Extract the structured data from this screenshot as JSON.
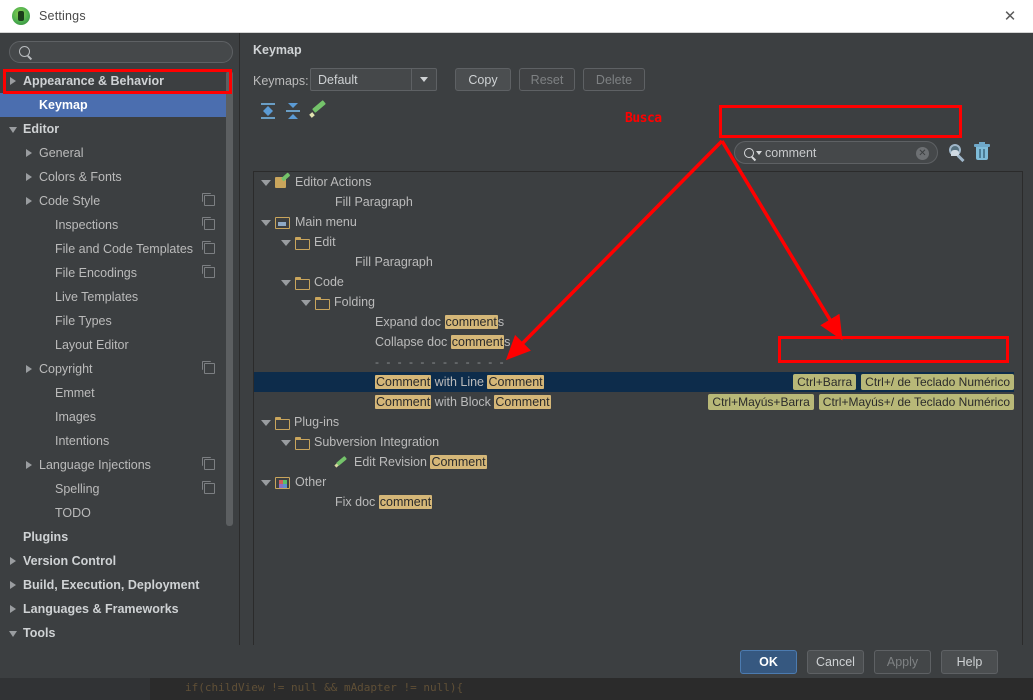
{
  "window": {
    "title": "Settings",
    "icon": "android-studio-icon",
    "close_label": "✕"
  },
  "sidebar": {
    "search_placeholder": "",
    "search_value": "",
    "search_icon": "search-icon",
    "items": [
      {
        "label": "Appearance & Behavior",
        "indent": 0,
        "twisty": "right",
        "bold": true,
        "badge": false,
        "selected": false
      },
      {
        "label": "Keymap",
        "indent": 1,
        "twisty": "none",
        "bold": true,
        "badge": false,
        "selected": true
      },
      {
        "label": "Editor",
        "indent": 0,
        "twisty": "down",
        "bold": true,
        "badge": false,
        "selected": false
      },
      {
        "label": "General",
        "indent": 1,
        "twisty": "right",
        "bold": false,
        "badge": false,
        "selected": false
      },
      {
        "label": "Colors & Fonts",
        "indent": 1,
        "twisty": "right",
        "bold": false,
        "badge": false,
        "selected": false
      },
      {
        "label": "Code Style",
        "indent": 1,
        "twisty": "right",
        "bold": false,
        "badge": true,
        "selected": false
      },
      {
        "label": "Inspections",
        "indent": 2,
        "twisty": "none",
        "bold": false,
        "badge": true,
        "selected": false
      },
      {
        "label": "File and Code Templates",
        "indent": 2,
        "twisty": "none",
        "bold": false,
        "badge": true,
        "selected": false
      },
      {
        "label": "File Encodings",
        "indent": 2,
        "twisty": "none",
        "bold": false,
        "badge": true,
        "selected": false
      },
      {
        "label": "Live Templates",
        "indent": 2,
        "twisty": "none",
        "bold": false,
        "badge": false,
        "selected": false
      },
      {
        "label": "File Types",
        "indent": 2,
        "twisty": "none",
        "bold": false,
        "badge": false,
        "selected": false
      },
      {
        "label": "Layout Editor",
        "indent": 2,
        "twisty": "none",
        "bold": false,
        "badge": false,
        "selected": false
      },
      {
        "label": "Copyright",
        "indent": 1,
        "twisty": "right",
        "bold": false,
        "badge": true,
        "selected": false
      },
      {
        "label": "Emmet",
        "indent": 2,
        "twisty": "none",
        "bold": false,
        "badge": false,
        "selected": false
      },
      {
        "label": "Images",
        "indent": 2,
        "twisty": "none",
        "bold": false,
        "badge": false,
        "selected": false
      },
      {
        "label": "Intentions",
        "indent": 2,
        "twisty": "none",
        "bold": false,
        "badge": false,
        "selected": false
      },
      {
        "label": "Language Injections",
        "indent": 1,
        "twisty": "right",
        "bold": false,
        "badge": true,
        "selected": false
      },
      {
        "label": "Spelling",
        "indent": 2,
        "twisty": "none",
        "bold": false,
        "badge": true,
        "selected": false
      },
      {
        "label": "TODO",
        "indent": 2,
        "twisty": "none",
        "bold": false,
        "badge": false,
        "selected": false
      },
      {
        "label": "Plugins",
        "indent": 0,
        "twisty": "none",
        "bold": true,
        "badge": false,
        "selected": false
      },
      {
        "label": "Version Control",
        "indent": 0,
        "twisty": "right",
        "bold": true,
        "badge": false,
        "selected": false
      },
      {
        "label": "Build, Execution, Deployment",
        "indent": 0,
        "twisty": "right",
        "bold": true,
        "badge": false,
        "selected": false
      },
      {
        "label": "Languages & Frameworks",
        "indent": 0,
        "twisty": "right",
        "bold": true,
        "badge": false,
        "selected": false
      },
      {
        "label": "Tools",
        "indent": 0,
        "twisty": "down",
        "bold": true,
        "badge": false,
        "selected": false
      }
    ]
  },
  "main": {
    "panel_title": "Keymap",
    "keymaps_label": "Keymaps:",
    "keymap_selected": "Default",
    "keymap_options": [
      "Default"
    ],
    "buttons": {
      "copy": "Copy",
      "reset": "Reset",
      "delete": "Delete"
    },
    "toolbar_icons": [
      "expand-all-icon",
      "collapse-all-icon",
      "edit-shortcut-icon"
    ],
    "search": {
      "value": "comment",
      "icon": "search-icon",
      "clear_icon": "clear-icon",
      "find_by_shortcut_icon": "find-by-shortcut-icon",
      "reset_filter_icon": "trash-icon"
    }
  },
  "annotations": {
    "busca_label": "Busca",
    "color": "#ff0000",
    "boxes": [
      "keymap-sidebar-item",
      "keymap-search-field",
      "shortcut-assignments"
    ]
  },
  "action_tree": [
    {
      "indent": 0,
      "twisty": "down",
      "icon": "editor-actions-icon",
      "parts": [
        {
          "t": "Editor Actions",
          "h": false
        }
      ],
      "shortcuts": [],
      "selected": false
    },
    {
      "indent": 3,
      "twisty": "none",
      "icon": "none",
      "parts": [
        {
          "t": "Fill Paragraph",
          "h": false
        }
      ],
      "shortcuts": [],
      "selected": false
    },
    {
      "indent": 0,
      "twisty": "down",
      "icon": "main-menu-icon",
      "parts": [
        {
          "t": "Main menu",
          "h": false
        }
      ],
      "shortcuts": [],
      "selected": false
    },
    {
      "indent": 1,
      "twisty": "down",
      "icon": "folder-icon",
      "parts": [
        {
          "t": "Edit",
          "h": false
        }
      ],
      "shortcuts": [],
      "selected": false
    },
    {
      "indent": 4,
      "twisty": "none",
      "icon": "none",
      "parts": [
        {
          "t": "Fill Paragraph",
          "h": false
        }
      ],
      "shortcuts": [],
      "selected": false
    },
    {
      "indent": 1,
      "twisty": "down",
      "icon": "folder-icon",
      "parts": [
        {
          "t": "Code",
          "h": false
        }
      ],
      "shortcuts": [],
      "selected": false
    },
    {
      "indent": 2,
      "twisty": "down",
      "icon": "folder-icon",
      "parts": [
        {
          "t": "Folding",
          "h": false
        }
      ],
      "shortcuts": [],
      "selected": false
    },
    {
      "indent": 5,
      "twisty": "none",
      "icon": "none",
      "parts": [
        {
          "t": "Expand doc ",
          "h": false
        },
        {
          "t": "comment",
          "h": true
        },
        {
          "t": "s",
          "h": false
        }
      ],
      "shortcuts": [],
      "selected": false
    },
    {
      "indent": 5,
      "twisty": "none",
      "icon": "none",
      "parts": [
        {
          "t": "Collapse doc ",
          "h": false
        },
        {
          "t": "comment",
          "h": true
        },
        {
          "t": "s",
          "h": false
        }
      ],
      "shortcuts": [],
      "selected": false
    },
    {
      "indent": 5,
      "twisty": "none",
      "icon": "none",
      "parts": [
        {
          "t": "- - - - - - - - - - - -",
          "h": false,
          "dash": true
        }
      ],
      "shortcuts": [],
      "selected": false
    },
    {
      "indent": 5,
      "twisty": "none",
      "icon": "none",
      "parts": [
        {
          "t": "Comment",
          "h": true
        },
        {
          "t": " with Line ",
          "h": false
        },
        {
          "t": "Comment",
          "h": true
        }
      ],
      "shortcuts": [
        "Ctrl+Barra",
        "Ctrl+/ de Teclado Numérico"
      ],
      "selected": true
    },
    {
      "indent": 5,
      "twisty": "none",
      "icon": "none",
      "parts": [
        {
          "t": "Comment",
          "h": true
        },
        {
          "t": " with Block ",
          "h": false
        },
        {
          "t": "Comment",
          "h": true
        }
      ],
      "shortcuts": [
        "Ctrl+Mayús+Barra",
        "Ctrl+Mayús+/ de Teclado Numérico"
      ],
      "selected": false
    },
    {
      "indent": 0,
      "twisty": "down",
      "icon": "folder-icon",
      "parts": [
        {
          "t": "Plug-ins",
          "h": false
        }
      ],
      "shortcuts": [],
      "selected": false
    },
    {
      "indent": 1,
      "twisty": "down",
      "icon": "folder-icon",
      "parts": [
        {
          "t": "Subversion Integration",
          "h": false
        }
      ],
      "shortcuts": [],
      "selected": false
    },
    {
      "indent": 3,
      "twisty": "none",
      "icon": "pencil-icon",
      "parts": [
        {
          "t": "Edit Revision ",
          "h": false
        },
        {
          "t": "Comment",
          "h": true
        }
      ],
      "shortcuts": [],
      "selected": false
    },
    {
      "indent": 0,
      "twisty": "down",
      "icon": "other-icon",
      "parts": [
        {
          "t": "Other",
          "h": false
        }
      ],
      "shortcuts": [],
      "selected": false
    },
    {
      "indent": 3,
      "twisty": "none",
      "icon": "none",
      "parts": [
        {
          "t": "Fix doc ",
          "h": false
        },
        {
          "t": "comment",
          "h": true
        }
      ],
      "shortcuts": [],
      "selected": false
    }
  ],
  "footer": {
    "ok": "OK",
    "cancel": "Cancel",
    "apply": "Apply",
    "help": "Help"
  },
  "behind_editor": {
    "code_snippet": "if(childView != null && mAdapter != null){"
  }
}
